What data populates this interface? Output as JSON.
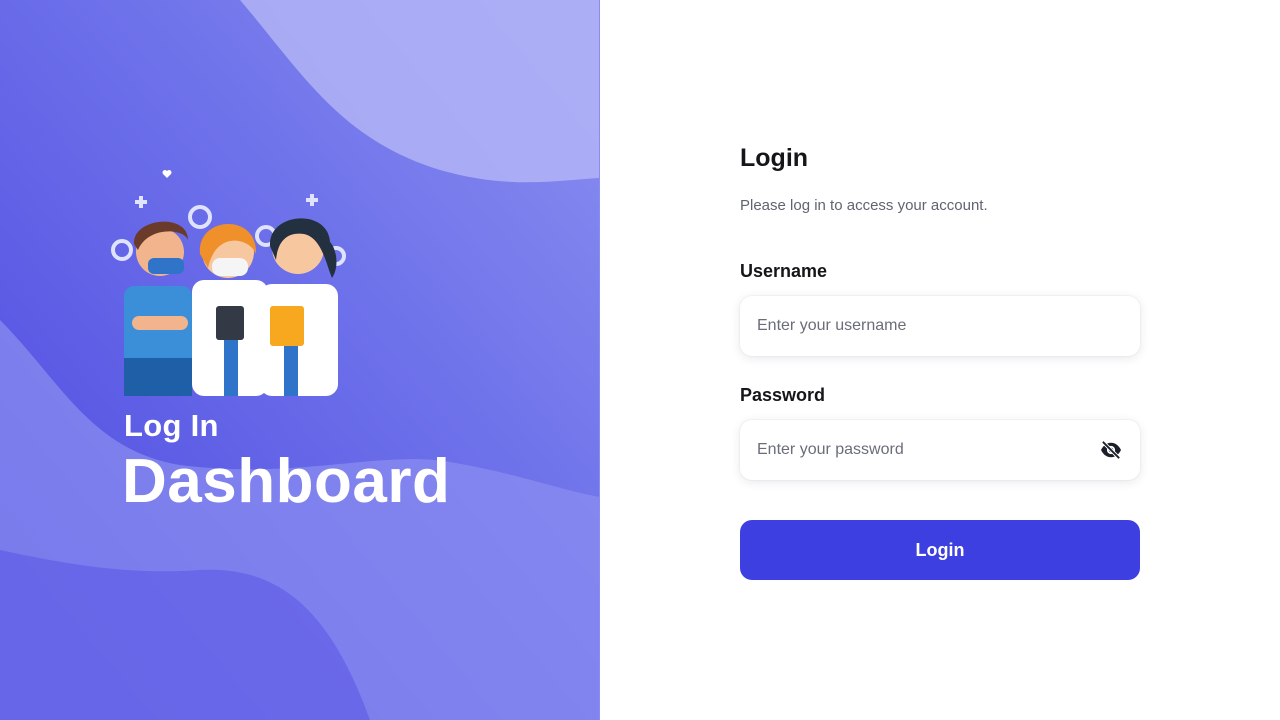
{
  "hero": {
    "subtitle": "Log In",
    "title": "Dashboard",
    "illustration_icon": "medical-team-illustration"
  },
  "form": {
    "title": "Login",
    "description": "Please log in to access your account.",
    "username_label": "Username",
    "username_placeholder": "Enter your username",
    "username_value": "",
    "password_label": "Password",
    "password_placeholder": "Enter your password",
    "password_value": "",
    "password_toggle_icon": "eye-slash-icon",
    "submit_label": "Login"
  },
  "colors": {
    "accent": "#3d3fe0",
    "panel": "#6b6fe6"
  }
}
